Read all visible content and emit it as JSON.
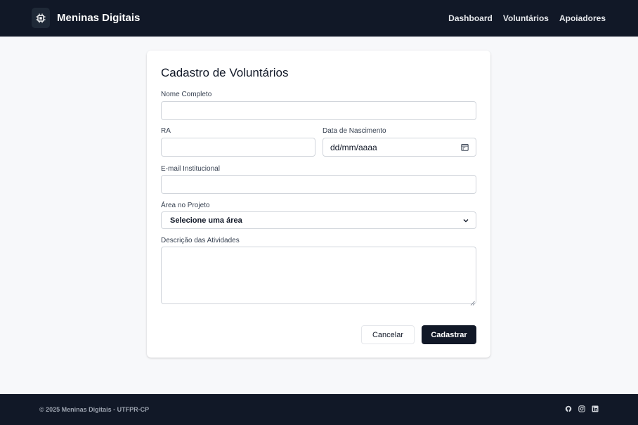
{
  "navbar": {
    "brand": "Meninas Digitais",
    "logo_icon": "cpu-chip-icon",
    "links": [
      "Dashboard",
      "Voluntários",
      "Apoiadores"
    ]
  },
  "form": {
    "title": "Cadastro de Voluntários",
    "full_name": {
      "label": "Nome Completo",
      "value": ""
    },
    "ra": {
      "label": "RA",
      "value": ""
    },
    "birth_date": {
      "label": "Data de Nascimento",
      "placeholder": "dd/mm/aaaa",
      "icon": "calendar-icon"
    },
    "email": {
      "label": "E-mail Institucional",
      "value": ""
    },
    "area": {
      "label": "Área no Projeto",
      "selected": "Selecione uma área",
      "icon": "chevron-down-icon"
    },
    "description": {
      "label": "Descrição das Atividades",
      "value": ""
    },
    "cancel_label": "Cancelar",
    "submit_label": "Cadastrar"
  },
  "footer": {
    "copyright": "© 2025 Meninas Digitais - UTFPR-CP",
    "social_icons": [
      "github-icon",
      "instagram-icon",
      "linkedin-icon"
    ]
  },
  "colors": {
    "navbar_bg": "#111827",
    "page_bg": "#f7f8fa",
    "primary_button": "#111827"
  }
}
